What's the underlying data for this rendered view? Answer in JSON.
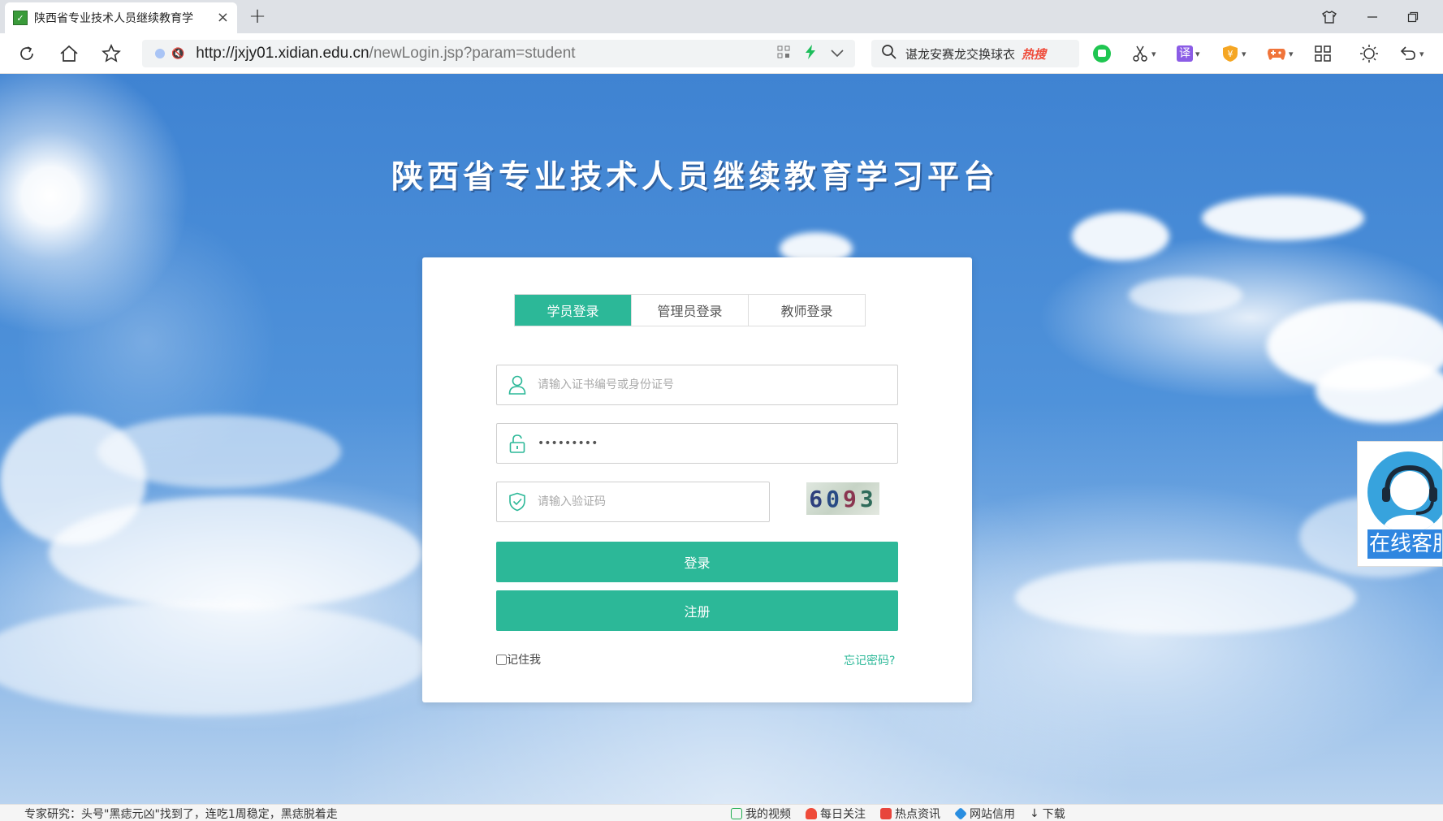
{
  "browser": {
    "tab_title": "陕西省专业技术人员继续教育学",
    "tab_close": "×",
    "new_tab": "+",
    "url_host": "http://jxjy01.xidian.edu.cn",
    "url_path": "/newLogin.jsp?param=student",
    "search_text": "谌龙安赛龙交换球衣",
    "search_badge": "热搜",
    "translate_label": "译",
    "icons": [
      "reload-icon",
      "home-icon",
      "star-icon",
      "qr-icon",
      "lightning-icon",
      "chevron-down-icon",
      "search-icon",
      "wechat-icon",
      "scissors-icon",
      "translate-icon",
      "coin-icon",
      "game-icon",
      "grid-icon",
      "brightness-icon",
      "undo-icon",
      "shirt-icon",
      "minimize-icon",
      "restore-icon"
    ]
  },
  "page": {
    "title": "陕西省专业技术人员继续教育学习平台",
    "login_tabs": [
      {
        "label": "学员登录",
        "active": true
      },
      {
        "label": "管理员登录",
        "active": false
      },
      {
        "label": "教师登录",
        "active": false
      }
    ],
    "username_placeholder": "请输入证书编号或身份证号",
    "password_value": "123456789",
    "captcha_placeholder": "请输入验证码",
    "captcha_digits": [
      "6",
      "0",
      "9",
      "3"
    ],
    "login_button": "登录",
    "register_button": "注册",
    "remember_label": "记住我",
    "forgot_link": "忘记密码?",
    "service_label": "在线客服",
    "accent_color": "#2cb898"
  },
  "statusbar": {
    "news": "专家研究：头号\"黑痣元凶\"找到了，连吃1周稳定，黑痣脱着走",
    "items": [
      "我的视频",
      "每日关注",
      "热点资讯",
      "网站信用",
      "下载"
    ]
  }
}
